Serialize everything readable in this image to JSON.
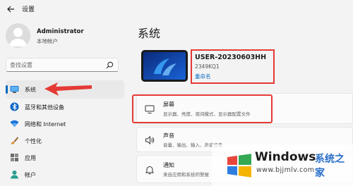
{
  "window": {
    "title": "设置"
  },
  "account": {
    "name": "Administrator",
    "type": "本地帐户"
  },
  "search": {
    "placeholder": "查找设置"
  },
  "nav": {
    "items": [
      {
        "label": "系统",
        "icon": "monitor-icon",
        "active": true
      },
      {
        "label": "蓝牙和其他设备",
        "icon": "bluetooth-icon"
      },
      {
        "label": "网络和 Internet",
        "icon": "wifi-icon"
      },
      {
        "label": "个性化",
        "icon": "paintbrush-icon"
      },
      {
        "label": "应用",
        "icon": "apps-icon"
      },
      {
        "label": "帐户",
        "icon": "person-icon"
      }
    ]
  },
  "main": {
    "title": "系统",
    "device": {
      "name": "USER-20230603HH",
      "model": "2349KQ1",
      "rename": "重命名"
    },
    "cards": [
      {
        "title": "屏幕",
        "subtitle": "显示器、亮度、夜间模式、显示器配置文件",
        "icon": "display-icon"
      },
      {
        "title": "声音",
        "subtitle": "音量、输出、输入、声音设备",
        "icon": "speaker-icon"
      },
      {
        "title": "通知",
        "subtitle": "来自应用和系统的警报",
        "icon": "bell-icon"
      }
    ]
  },
  "watermark": {
    "brand": "Windows",
    "brand_cn": "系统之家",
    "url": "www.bjjmlv.com"
  },
  "colors": {
    "accent": "#0067c0",
    "annotation": "#e53935",
    "background": "#f3f3f3",
    "card": "#fbfbfb"
  }
}
